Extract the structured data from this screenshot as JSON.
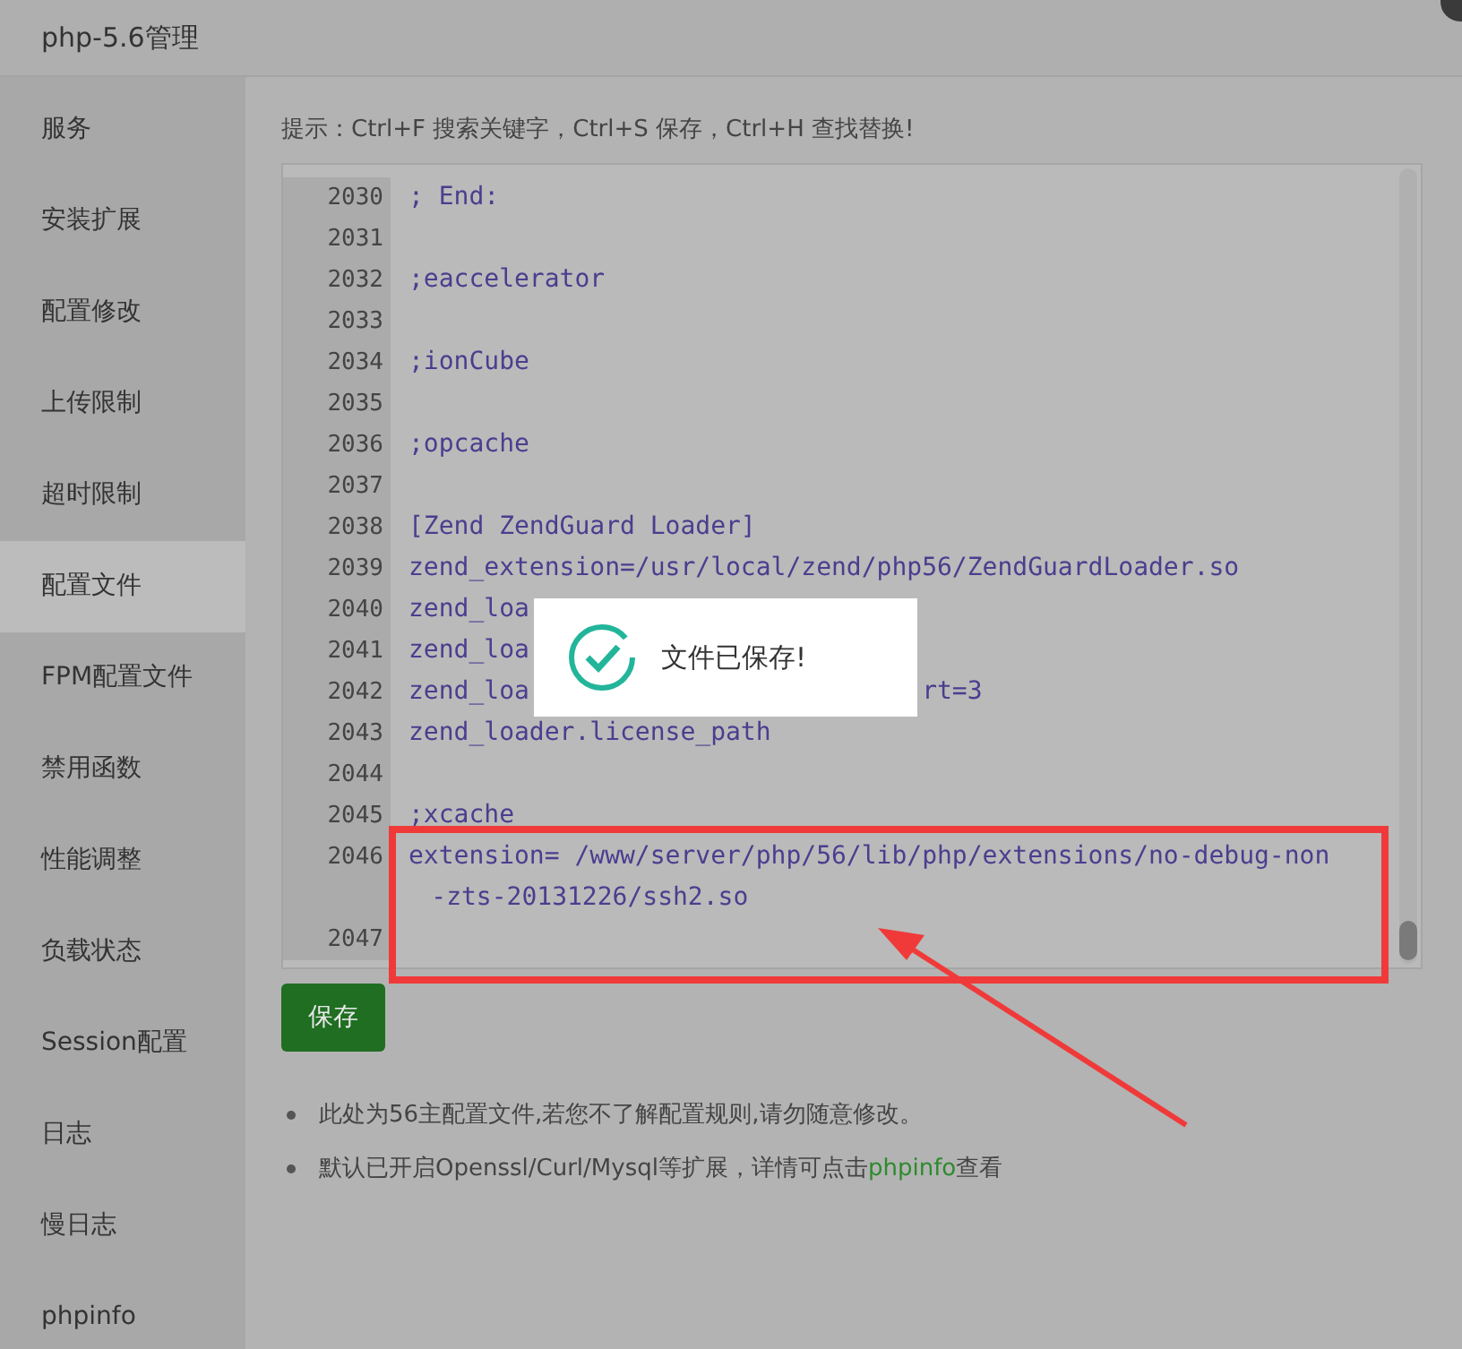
{
  "window": {
    "title": "php-5.6管理"
  },
  "sidebar": {
    "items": [
      {
        "label": "服务",
        "selected": false
      },
      {
        "label": "安装扩展",
        "selected": false
      },
      {
        "label": "配置修改",
        "selected": false
      },
      {
        "label": "上传限制",
        "selected": false
      },
      {
        "label": "超时限制",
        "selected": false
      },
      {
        "label": "配置文件",
        "selected": true
      },
      {
        "label": "FPM配置文件",
        "selected": false
      },
      {
        "label": "禁用函数",
        "selected": false
      },
      {
        "label": "性能调整",
        "selected": false
      },
      {
        "label": "负载状态",
        "selected": false
      },
      {
        "label": "Session配置",
        "selected": false
      },
      {
        "label": "日志",
        "selected": false
      },
      {
        "label": "慢日志",
        "selected": false
      },
      {
        "label": "phpinfo",
        "selected": false
      }
    ]
  },
  "hint": "提示：Ctrl+F 搜索关键字，Ctrl+S 保存，Ctrl+H 查找替换!",
  "editor": {
    "lines": [
      {
        "number": "2030",
        "text": "; End:"
      },
      {
        "number": "2031"
      },
      {
        "number": "2032",
        "text": ";eaccelerator"
      },
      {
        "number": "2033"
      },
      {
        "number": "2034",
        "text": ";ionCube"
      },
      {
        "number": "2035"
      },
      {
        "number": "2036",
        "text": ";opcache"
      },
      {
        "number": "2037"
      },
      {
        "number": "2038",
        "text": "[Zend ZendGuard Loader]"
      },
      {
        "number": "2039",
        "text": "zend_extension=/usr/local/zend/php56/ZendGuardLoader.so"
      },
      {
        "number": "2040",
        "text": "zend_loa"
      },
      {
        "number": "2041",
        "text": "zend_loa"
      },
      {
        "number": "2042",
        "text": "zend_loa                          rt=3"
      },
      {
        "number": "2043",
        "text": "zend_loader.license_path"
      },
      {
        "number": "2044"
      },
      {
        "number": "2045",
        "text": ";xcache"
      },
      {
        "number": "2046",
        "text": "extension= /www/server/php/56/lib/php/extensions/no-debug-non-zts-20131226/ssh2.so"
      },
      {
        "number": "2047"
      }
    ]
  },
  "save_button": "保存",
  "notes": [
    {
      "text": "此处为56主配置文件,若您不了解配置规则,请勿随意修改。"
    },
    {
      "text": "默认已开启Openssl/Curl/Mysql等扩展，详情可点击",
      "link": "phpinfo",
      "after": "查看"
    }
  ],
  "toast": {
    "message": "文件已保存!"
  }
}
